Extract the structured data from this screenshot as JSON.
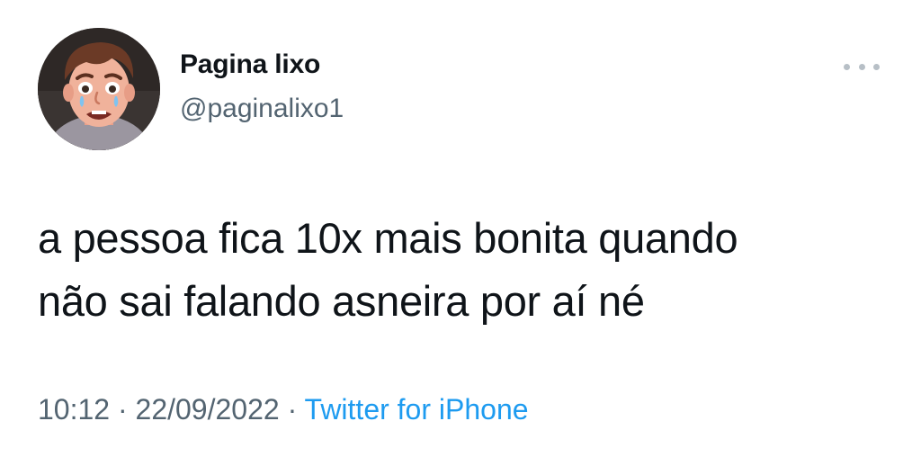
{
  "author": {
    "display_name": "Pagina lixo",
    "handle": "@paginalixo1",
    "avatar_icon": "crying-cartoon-man-avatar"
  },
  "tweet": {
    "lines": [
      "a pessoa fica 10x mais bonita quando",
      "não sai falando asneira por aí né"
    ]
  },
  "meta": {
    "time": "10:12",
    "separator": "·",
    "date": "22/09/2022",
    "source": "Twitter for iPhone"
  },
  "colors": {
    "text": "#0f1419",
    "secondary": "#536471",
    "link": "#1d9bf0",
    "more_dots": "#b7bfc6"
  },
  "icons": {
    "more": "more-horizontal-icon"
  }
}
